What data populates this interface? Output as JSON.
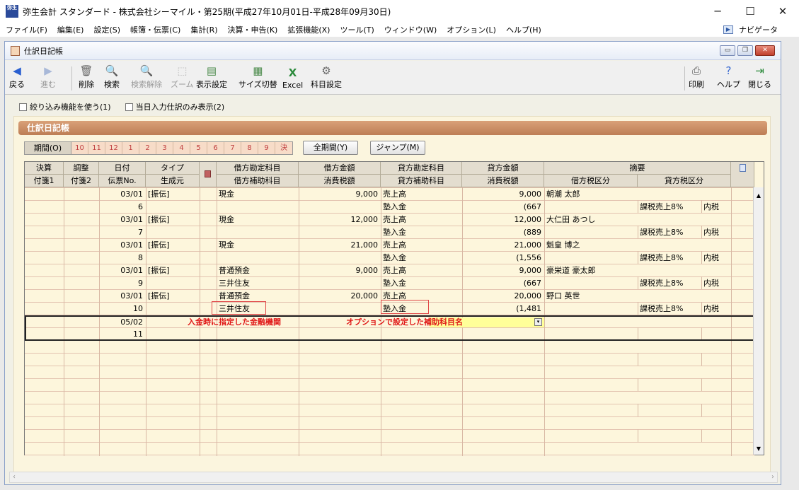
{
  "window": {
    "title": "弥生会計 スタンダード - 株式会社シーマイル・第25期(平成27年10月01日-平成28年09月30日)",
    "app_icon_text": "弥生",
    "controls": {
      "minimize": "─",
      "maximize": "☐",
      "close": "✕"
    }
  },
  "menu": {
    "items": [
      "ファイル(F)",
      "編集(E)",
      "設定(S)",
      "帳簿・伝票(C)",
      "集計(R)",
      "決算・申告(K)",
      "拡張機能(X)",
      "ツール(T)",
      "ウィンドウ(W)",
      "オプション(L)",
      "ヘルプ(H)"
    ],
    "navigator": "ナビゲータ"
  },
  "child_window": {
    "title": "仕訳日記帳",
    "controls": {
      "minimize": "▭",
      "restore": "❐",
      "close": "✕"
    }
  },
  "toolbar": {
    "back": "戻る",
    "forward": "進む",
    "delete": "削除",
    "search": "検索",
    "clear_search": "検索解除",
    "zoom": "ズーム",
    "display_settings": "表示設定",
    "size_switch": "サイズ切替",
    "excel": "Excel",
    "account_settings": "科目設定",
    "print": "印刷",
    "help": "ヘルプ",
    "close": "閉じる"
  },
  "filters": {
    "narrow": "絞り込み機能を使う(1)",
    "today_only": "当日入力仕訳のみ表示(2)"
  },
  "panel": {
    "title": "仕訳日記帳",
    "period_label": "期間(O)",
    "periods": [
      "10",
      "11",
      "12",
      "1",
      "2",
      "3",
      "4",
      "5",
      "6",
      "7",
      "8",
      "9",
      "決"
    ],
    "all_periods_button": "全期間(Y)",
    "jump_button": "ジャンプ(M)"
  },
  "table": {
    "headers_top": [
      "決算",
      "調整",
      "日付",
      "タイプ",
      "",
      "借方勘定科目",
      "借方金額",
      "貸方勘定科目",
      "貸方金額",
      "摘要"
    ],
    "headers_bottom": [
      "付箋1",
      "付箋2",
      "伝票No.",
      "生成元",
      "",
      "借方補助科目",
      "消費税額",
      "貸方補助科目",
      "消費税額",
      "借方税区分",
      "貸方税区分"
    ],
    "entries": [
      {
        "date": "03/01",
        "no": "6",
        "type": "[振伝]",
        "debit": "現金",
        "debit_sub": "",
        "debit_amt": "9,000",
        "credit": "売上高",
        "credit_sub": "塾入金",
        "credit_amt": "9,000",
        "credit_tax": "(667",
        "memo": "朝潮 太郎",
        "tax_class": "課税売上8%",
        "tax_mode": "内税"
      },
      {
        "date": "03/01",
        "no": "7",
        "type": "[振伝]",
        "debit": "現金",
        "debit_sub": "",
        "debit_amt": "12,000",
        "credit": "売上高",
        "credit_sub": "塾入金",
        "credit_amt": "12,000",
        "credit_tax": "(889",
        "memo": "大仁田 あつし",
        "tax_class": "課税売上8%",
        "tax_mode": "内税"
      },
      {
        "date": "03/01",
        "no": "8",
        "type": "[振伝]",
        "debit": "現金",
        "debit_sub": "",
        "debit_amt": "21,000",
        "credit": "売上高",
        "credit_sub": "塾入金",
        "credit_amt": "21,000",
        "credit_tax": "(1,556",
        "memo": "魁皇 博之",
        "tax_class": "課税売上8%",
        "tax_mode": "内税"
      },
      {
        "date": "03/01",
        "no": "9",
        "type": "[振伝]",
        "debit": "普通預金",
        "debit_sub": "三井住友",
        "debit_amt": "9,000",
        "credit": "売上高",
        "credit_sub": "塾入金",
        "credit_amt": "9,000",
        "credit_tax": "(667",
        "memo": "豪栄道 豪太郎",
        "tax_class": "課税売上8%",
        "tax_mode": "内税"
      },
      {
        "date": "03/01",
        "no": "10",
        "type": "[振伝]",
        "debit": "普通預金",
        "debit_sub": "三井住友",
        "debit_amt": "20,000",
        "credit": "売上高",
        "credit_sub": "塾入金",
        "credit_amt": "20,000",
        "credit_tax": "(1,481",
        "memo": "野口 英世",
        "tax_class": "課税売上8%",
        "tax_mode": "内税"
      }
    ],
    "new_entry": {
      "date": "05/02",
      "no": "11",
      "note_bank": "入金時に指定した金融機関",
      "note_sub": "オプションで設定した補助科目名"
    }
  }
}
